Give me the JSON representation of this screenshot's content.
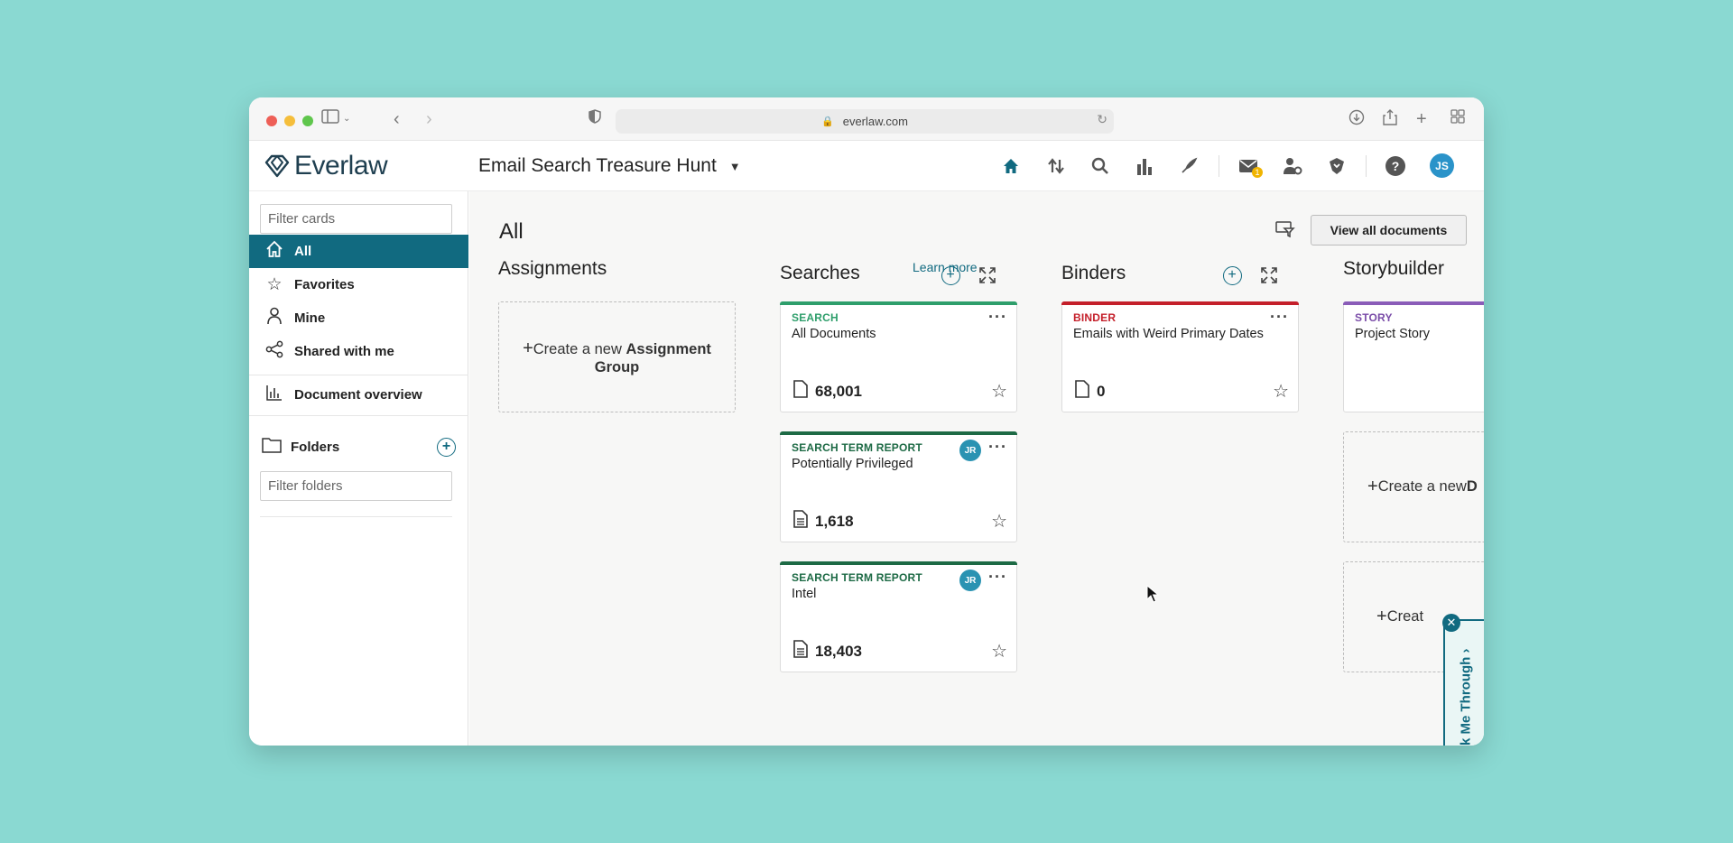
{
  "browser": {
    "url": "everlaw.com"
  },
  "app": {
    "brand": "Everlaw",
    "project_title": "Email Search Treasure Hunt",
    "mail_badge": "1",
    "user_initials": "JS",
    "help_label": "?"
  },
  "sidebar": {
    "filter_cards_placeholder": "Filter cards",
    "items": [
      {
        "label": "All",
        "icon": "home-icon",
        "active": true
      },
      {
        "label": "Favorites",
        "icon": "star-icon"
      },
      {
        "label": "Mine",
        "icon": "person-icon"
      },
      {
        "label": "Shared with me",
        "icon": "share-icon"
      },
      {
        "label": "Document overview",
        "icon": "bar-chart-icon"
      }
    ],
    "folders_label": "Folders",
    "filter_folders_placeholder": "Filter folders"
  },
  "main": {
    "heading": "All",
    "view_all_label": "View all documents",
    "columns": {
      "assignments": {
        "title": "Assignments",
        "learn_more": "Learn more",
        "create_prefix": "Create a new ",
        "create_bold": "Assignment Group"
      },
      "searches": {
        "title": "Searches",
        "cards": [
          {
            "type": "SEARCH",
            "title": "All Documents",
            "count": "68,001",
            "type_color": "#2e9e6b",
            "bar_color": "#2e9e6b"
          },
          {
            "type": "SEARCH TERM REPORT",
            "title": "Potentially Privileged",
            "count": "1,618",
            "type_color": "#1d6a45",
            "bar_color": "#1d6a45",
            "avatar": "JR"
          },
          {
            "type": "SEARCH TERM REPORT",
            "title": "Intel",
            "count": "18,403",
            "type_color": "#1d6a45",
            "bar_color": "#1d6a45",
            "avatar": "JR"
          }
        ]
      },
      "binders": {
        "title": "Binders",
        "cards": [
          {
            "type": "BINDER",
            "title": "Emails with Weird Primary Dates",
            "count": "0",
            "type_color": "#c41f2a",
            "bar_color": "#c41f2a"
          }
        ]
      },
      "storybuilder": {
        "title": "Storybuilder",
        "cards": [
          {
            "type": "STORY",
            "title": "Project Story",
            "type_color": "#7a4ca8",
            "bar_color": "#8a5cb8"
          }
        ],
        "create_1_prefix": "Create a new ",
        "create_1_bold": "D",
        "create_2": "Creat"
      }
    }
  },
  "walkthrough": {
    "label": "k Me Through ›"
  },
  "colors": {
    "teal_primary": "#116a80",
    "background": "#8ad9d2",
    "avatar_blue": "#2a93c9"
  }
}
